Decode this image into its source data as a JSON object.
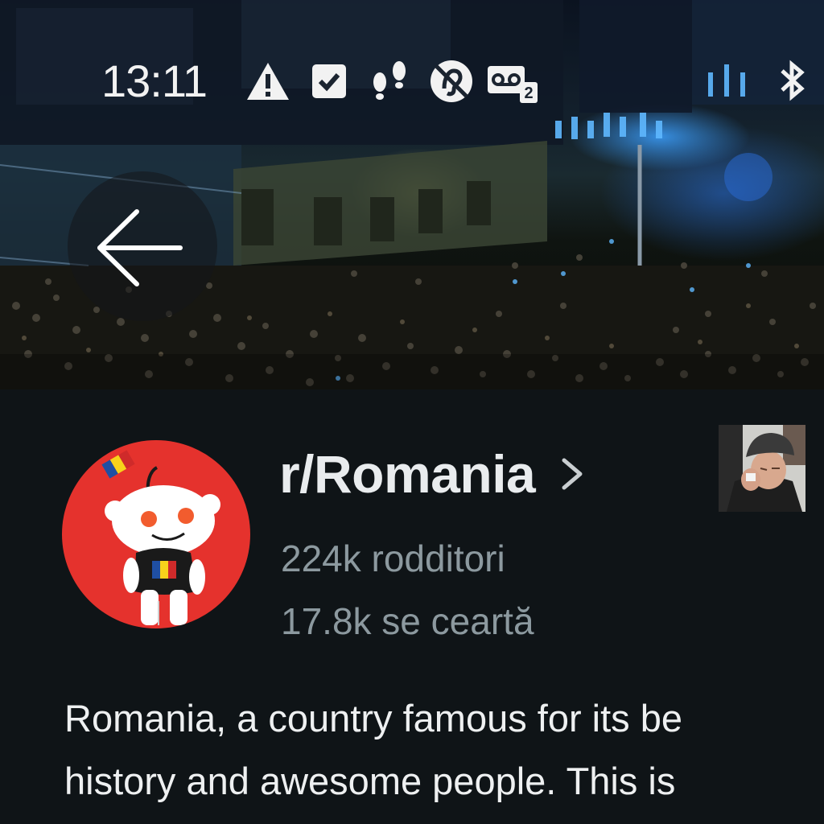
{
  "status_bar": {
    "time": "13:11",
    "icons": [
      "warning-icon",
      "check-box-icon",
      "footsteps-icon",
      "hearing-off-icon",
      "voicemail-icon",
      "bluetooth-icon"
    ],
    "voicemail_count": "2"
  },
  "banner": {
    "image": "night-protest-crowd-photo"
  },
  "header": {
    "back_icon": "arrow-left-icon"
  },
  "community": {
    "name": "r/Romania",
    "members": "224k rodditori",
    "online": "17.8k se ceartă",
    "avatar": "snoo-romanian-flag-avatar",
    "moderator_thumbnail": "man-wiping-tears-photo",
    "description_lines": [
      "Romania, a country famous for its be",
      "history and awesome people. This is"
    ]
  },
  "colors": {
    "background": "#0f1417",
    "avatar_red": "#e5322d",
    "muted_text": "#8c999f",
    "primary_text": "#e9ecee"
  }
}
